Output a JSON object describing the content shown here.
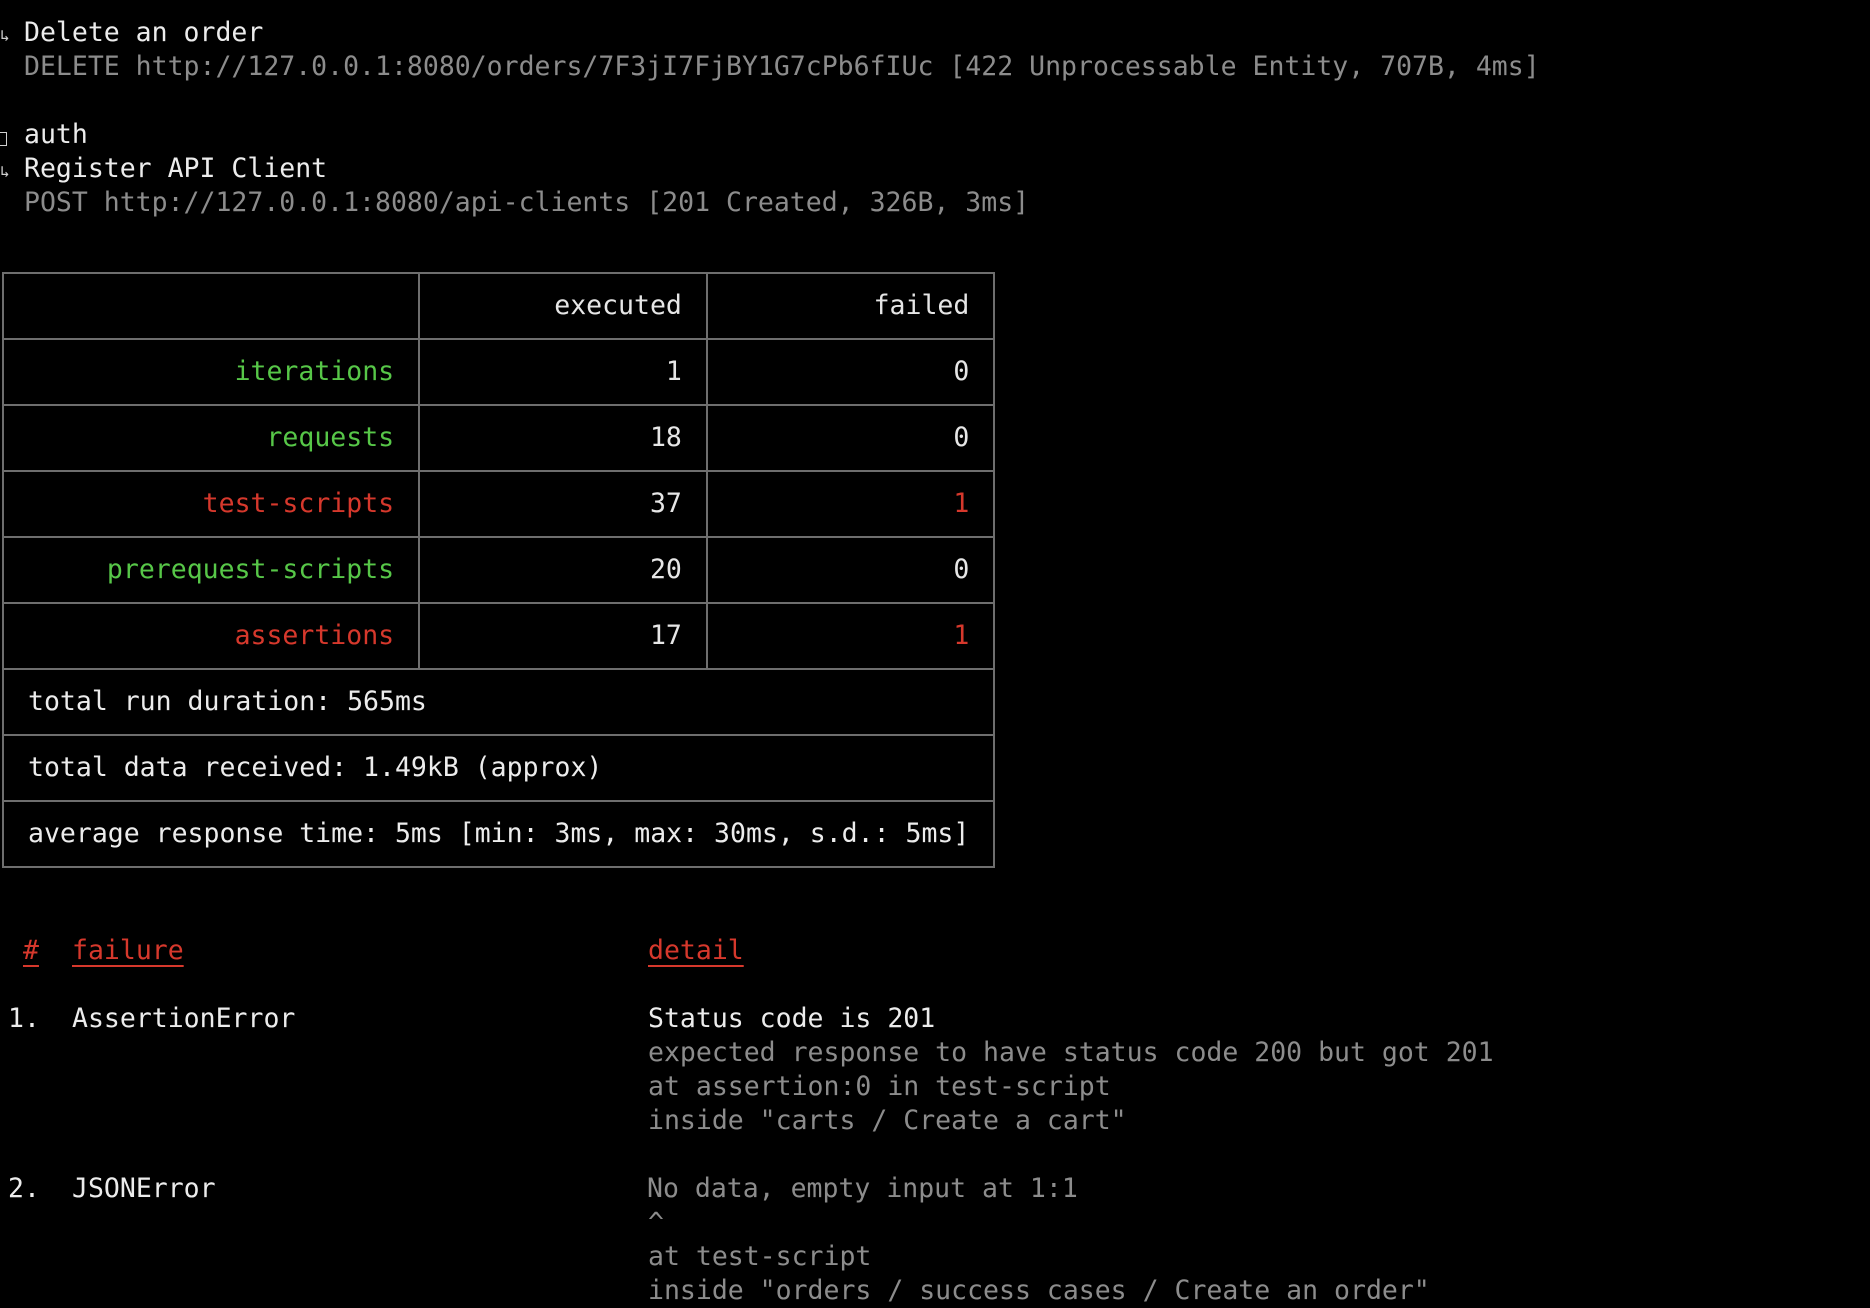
{
  "log": {
    "request1": {
      "marker": "↳",
      "name": "Delete an order",
      "detail": "DELETE http://127.0.0.1:8080/orders/7F3jI7FjBY1G7cPb6fIUc [422 Unprocessable Entity, 707B, 4ms]"
    },
    "folder": {
      "name": "auth"
    },
    "request2": {
      "marker": "↳",
      "name": "Register API Client",
      "detail": "POST http://127.0.0.1:8080/api-clients [201 Created, 326B, 3ms]"
    }
  },
  "summary": {
    "headers": [
      "",
      "executed",
      "failed"
    ],
    "rows": [
      {
        "label": "iterations",
        "executed": "1",
        "failed": "0",
        "status": "ok"
      },
      {
        "label": "requests",
        "executed": "18",
        "failed": "0",
        "status": "ok"
      },
      {
        "label": "test-scripts",
        "executed": "37",
        "failed": "1",
        "status": "fail"
      },
      {
        "label": "prerequest-scripts",
        "executed": "20",
        "failed": "0",
        "status": "ok"
      },
      {
        "label": "assertions",
        "executed": "17",
        "failed": "1",
        "status": "fail"
      }
    ],
    "footer": [
      "total run duration: 565ms",
      "total data received: 1.49kB (approx)",
      "average response time: 5ms [min: 3ms, max: 30ms, s.d.: 5ms]"
    ]
  },
  "failures": {
    "headers": {
      "index": "#",
      "failure": "failure",
      "detail": "detail"
    },
    "items": [
      {
        "index": "1.",
        "type": "AssertionError",
        "title": "Status code is 201",
        "lines": [
          "expected response to have status code 200 but got 201",
          "at assertion:0 in test-script",
          "inside \"carts / Create a cart\""
        ]
      },
      {
        "index": "2.",
        "type": "JSONError",
        "title": "No data, empty input at 1:1",
        "lines": [
          "^",
          "at test-script",
          "inside \"orders / success cases / Create an order\""
        ]
      }
    ]
  },
  "colors": {
    "background": "#000000",
    "text": "#e6e6e6",
    "dim": "#8c8c8c",
    "ok": "#57c748",
    "fail": "#d6382c",
    "border": "#6e6e6e"
  }
}
